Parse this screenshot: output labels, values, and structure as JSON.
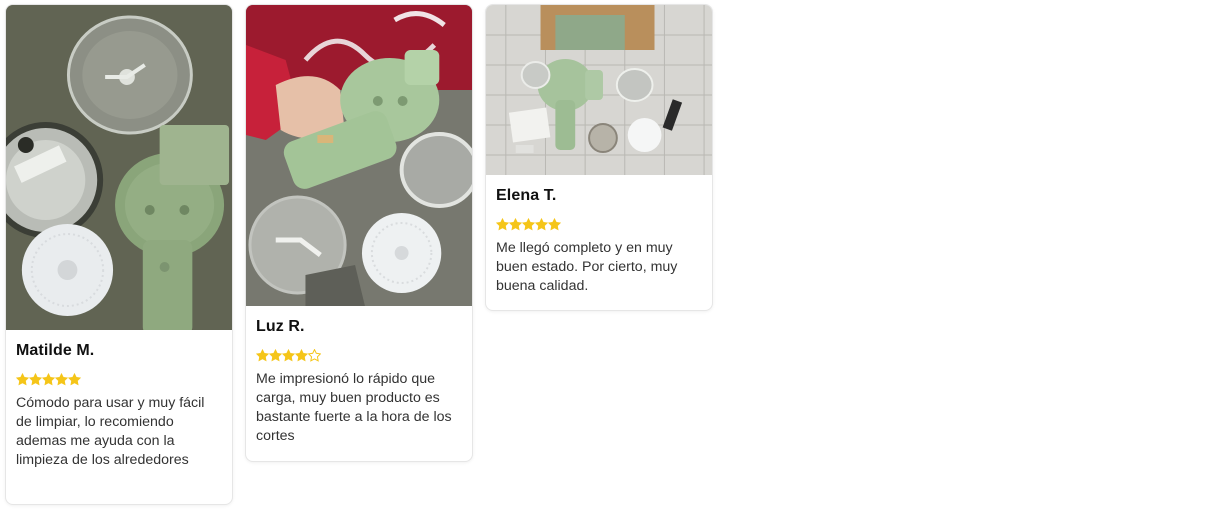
{
  "star_color": "#f5c518",
  "star_empty_color": "#f5c518",
  "reviews": [
    {
      "name": "Matilde M.",
      "rating": 5,
      "text": "Cómodo para usar y muy fácil de limpiar, lo recomiendo ademas me ayuda con la limpieza de los alrededores",
      "photo": "food-chopper-parts-photo"
    },
    {
      "name": "Luz R.",
      "rating": 4,
      "text": "Me impresionó lo rápido que carga, muy buen producto es bastante fuerte a la hora de los cortes",
      "photo": "hand-holding-chopper-photo"
    },
    {
      "name": "Elena T.",
      "rating": 5,
      "text": "Me llegó completo y en muy buen estado. Por cierto, muy buena calidad.",
      "photo": "unboxed-chopper-kit-photo"
    }
  ]
}
